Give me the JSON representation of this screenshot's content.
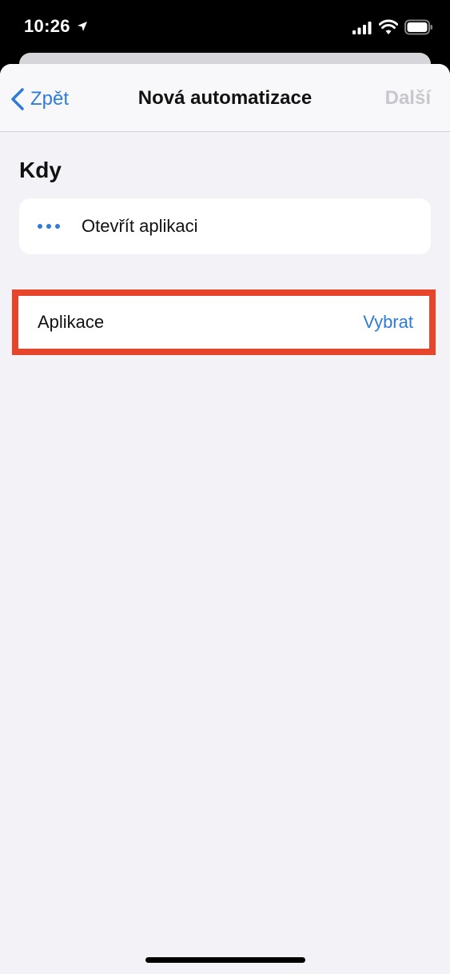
{
  "status_bar": {
    "time": "10:26"
  },
  "nav": {
    "back_label": "Zpět",
    "title": "Nová automatizace",
    "next_label": "Další"
  },
  "section": {
    "title": "Kdy"
  },
  "trigger": {
    "label": "Otevřít aplikaci"
  },
  "app_row": {
    "label": "Aplikace",
    "action": "Vybrat"
  },
  "colors": {
    "accent": "#2f7bd8",
    "highlight": "#e6452c",
    "background": "#f2f2f7",
    "disabled": "#c7c7cc"
  }
}
